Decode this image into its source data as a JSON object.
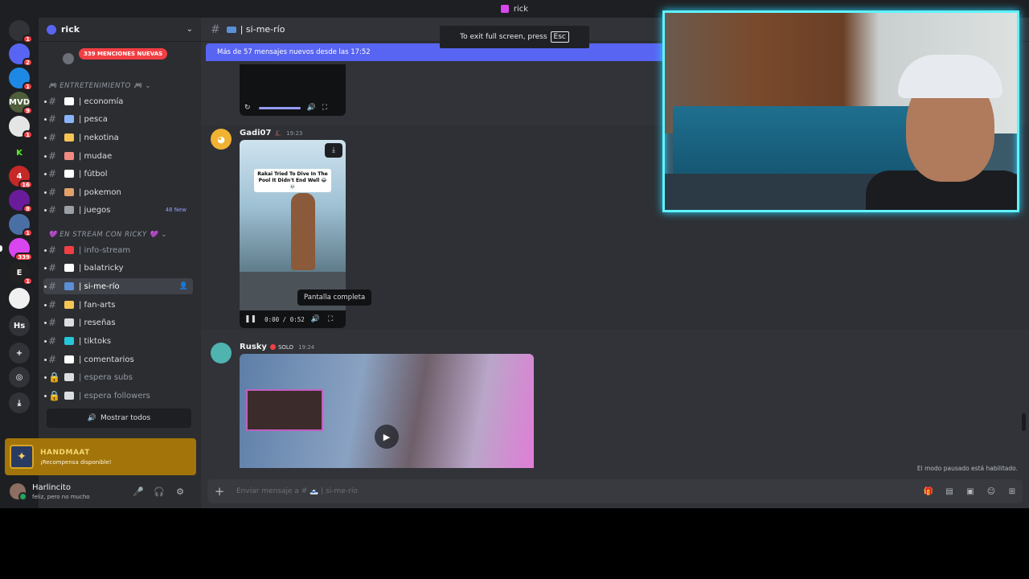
{
  "window": {
    "title": "rick"
  },
  "fullscreen_tip": {
    "text": "To exit full screen, press",
    "key": "Esc"
  },
  "servers": [
    {
      "name": "direct-messages",
      "label": "",
      "color": "#313338",
      "badge": "1"
    },
    {
      "name": "discord",
      "label": "",
      "color": "#5865f2",
      "badge": "2"
    },
    {
      "name": "cube",
      "label": "",
      "color": "#1e88e5",
      "badge": "1"
    },
    {
      "name": "mvd",
      "label": "MVD",
      "color": "#4e5d3a",
      "badge": "9"
    },
    {
      "name": "face",
      "label": "",
      "color": "#e5e5e5",
      "badge": "1"
    },
    {
      "name": "kick",
      "label": "K",
      "color": "#1e1f22",
      "badge": ""
    },
    {
      "name": "fourty",
      "label": "4",
      "color": "#c62828",
      "badge": "16"
    },
    {
      "name": "purple",
      "label": "",
      "color": "#6a1b9a",
      "badge": "8"
    },
    {
      "name": "earth",
      "label": "",
      "color": "#4a6fa5",
      "badge": "1"
    },
    {
      "name": "rick-server",
      "label": "",
      "color": "#d946ef",
      "badge": "339"
    },
    {
      "name": "ea",
      "label": "E",
      "color": "#222",
      "badge": "1"
    },
    {
      "name": "troll",
      "label": "",
      "color": "#f0f0f0",
      "badge": ""
    },
    {
      "name": "hs",
      "label": "Hs",
      "color": "#313338",
      "badge": ""
    },
    {
      "name": "add",
      "label": "+",
      "color": "#313338",
      "badge": ""
    },
    {
      "name": "explore",
      "label": "◎",
      "color": "#313338",
      "badge": ""
    },
    {
      "name": "download",
      "label": "⤓",
      "color": "#313338",
      "badge": ""
    }
  ],
  "server": {
    "name": "rick",
    "mentions": "339 MENCIONES NUEVAS"
  },
  "categories": {
    "entertainment": "🎮 ENTRETENIMIENTO 🎮 ⌄",
    "stream": "💜 EN STREAM CON RICKY 💜 ⌄"
  },
  "channels": [
    {
      "name": "| economía",
      "color": "#ffffff",
      "state": "normal",
      "extra": ""
    },
    {
      "name": "| pesca",
      "color": "#8ab4f8",
      "state": "normal",
      "extra": ""
    },
    {
      "name": "| nekotina",
      "color": "#f6c453",
      "state": "normal",
      "extra": ""
    },
    {
      "name": "| mudae",
      "color": "#f28b82",
      "state": "normal",
      "extra": ""
    },
    {
      "name": "| fútbol",
      "color": "#ffffff",
      "state": "normal",
      "extra": ""
    },
    {
      "name": "| pokemon",
      "color": "#e2a06b",
      "state": "normal",
      "extra": ""
    },
    {
      "name": "| juegos",
      "color": "#9aa0a6",
      "state": "normal",
      "extra": "48 New"
    },
    {
      "name": "| info-stream",
      "color": "#f23f43",
      "state": "muted",
      "extra": ""
    },
    {
      "name": "| balatricky",
      "color": "#ffffff",
      "state": "normal",
      "extra": ""
    },
    {
      "name": "| si-me-río",
      "color": "#5b8fd6",
      "state": "active",
      "extra": ""
    },
    {
      "name": "| fan-arts",
      "color": "#f6c453",
      "state": "normal",
      "extra": ""
    },
    {
      "name": "| reseñas",
      "color": "#dbdee1",
      "state": "normal",
      "extra": ""
    },
    {
      "name": "| tiktoks",
      "color": "#26c6da",
      "state": "normal",
      "extra": ""
    },
    {
      "name": "| comentarios",
      "color": "#ffffff",
      "state": "normal",
      "extra": ""
    },
    {
      "name": "| espera subs",
      "color": "#dbdee1",
      "state": "muted",
      "extra": ""
    },
    {
      "name": "| espera followers",
      "color": "#dbdee1",
      "state": "muted",
      "extra": ""
    }
  ],
  "show_all": "Mostrar todos",
  "reward": {
    "name": "HANDMAAT",
    "text": "¡Recompensa disponible!"
  },
  "user": {
    "name": "Harlincito",
    "status": "feliz, pero no mucho"
  },
  "channel_header": {
    "name": "| si-me-río"
  },
  "new_messages_banner": "Más de 57 mensajes nuevos desde las 17:52",
  "messages": [
    {
      "author": "Gadi07",
      "badge": "🎩",
      "time": "19:23",
      "video_caption": "Rakai Tried To Dive In The Pool It Didn't End Well 😂💀",
      "video_time": "0:00 / 0:52"
    },
    {
      "author": "Rusky",
      "role": "SOLO",
      "time": "19:24"
    }
  ],
  "tooltip": "Pantalla completa",
  "paused_note": "El modo pausado está habilitado.",
  "composer": {
    "placeholder": "Enviar mensaje a # 🗻 | si-me-río"
  }
}
